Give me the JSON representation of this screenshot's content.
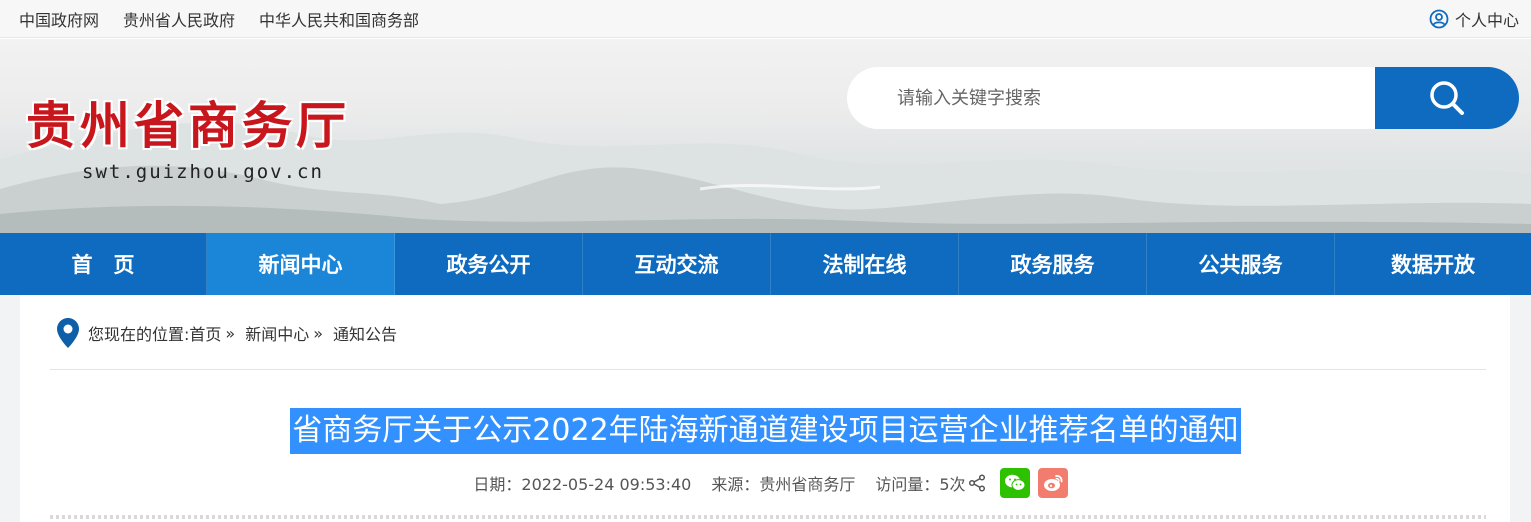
{
  "topbar": {
    "links": [
      "中国政府网",
      "贵州省人民政府",
      "中华人民共和国商务部"
    ],
    "user_label": "个人中心"
  },
  "banner": {
    "site_title": "贵州省商务厅",
    "site_domain": "swt.guizhou.gov.cn"
  },
  "search": {
    "placeholder": "请输入关键字搜索"
  },
  "nav": {
    "items": [
      "首　页",
      "新闻中心",
      "政务公开",
      "互动交流",
      "法制在线",
      "政务服务",
      "公共服务",
      "数据开放"
    ],
    "active": "新闻中心"
  },
  "breadcrumb": {
    "prefix": "您现在的位置:",
    "home": "首页",
    "level1": "新闻中心",
    "level2": "通知公告",
    "separator": "»"
  },
  "article": {
    "title": "省商务厅关于公示2022年陆海新通道建设项目运营企业推荐名单的通知",
    "date": "日期：2022-05-24 09:53:40",
    "source": "来源：贵州省商务厅",
    "visits": "访问量：5次"
  },
  "colors": {
    "brand_blue": "#0e6bbf",
    "nav_active": "#1b86d8",
    "title_red": "#c8161d",
    "selection_blue": "#3390ff"
  }
}
